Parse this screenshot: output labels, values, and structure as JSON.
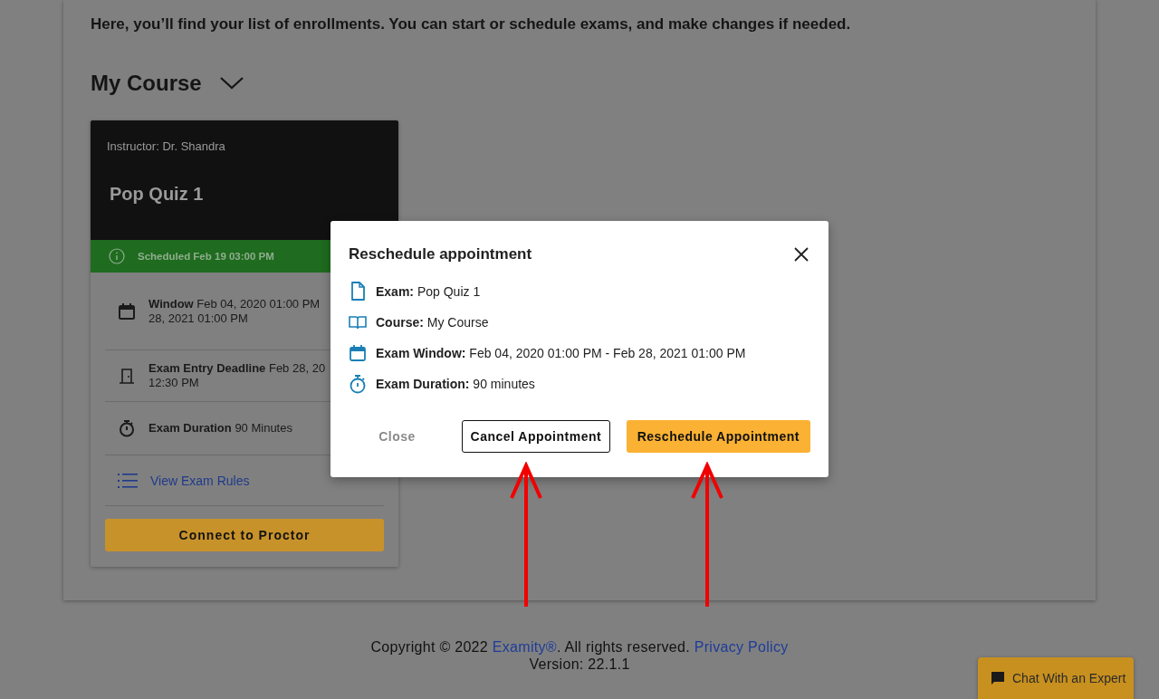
{
  "intro": "Here, you’ll find your list of enrollments. You can start or schedule exams, and make changes if needed.",
  "course": {
    "title": "My Course"
  },
  "card": {
    "instructor": "Instructor: Dr. Shandra",
    "title": "Pop Quiz 1",
    "status": "Scheduled Feb 19 03:00 PM",
    "rows": [
      {
        "kind": "window",
        "label": "Window",
        "lines": [
          "Feb 04, 2020 01:00 PM",
          "28, 2021 01:00 PM"
        ]
      },
      {
        "kind": "deadline",
        "label": "Exam Entry Deadline",
        "lines": [
          "Feb 28, 20",
          "12:30 PM"
        ]
      },
      {
        "kind": "duration",
        "label": "Exam Duration",
        "lines": [
          "90 Minutes"
        ]
      },
      {
        "kind": "rules",
        "label": "View Exam Rules"
      }
    ],
    "button": "Connect to Proctor"
  },
  "modal": {
    "title": "Reschedule appointment",
    "items": [
      {
        "kind": "exam",
        "label": "Exam:",
        "value": "Pop Quiz 1"
      },
      {
        "kind": "course",
        "label": "Course:",
        "value": "My Course"
      },
      {
        "kind": "window",
        "label": "Exam Window:",
        "value": "Feb 04, 2020 01:00 PM - Feb 28, 2021 01:00 PM"
      },
      {
        "kind": "duration",
        "label": "Exam Duration:",
        "value": "90 minutes"
      }
    ],
    "buttons": [
      {
        "kind": "text",
        "label": "Close"
      },
      {
        "kind": "outline",
        "label": "Cancel Appointment"
      },
      {
        "kind": "primary",
        "label": "Reschedule Appointment"
      }
    ]
  },
  "annotations": [
    {
      "kind": "arrow"
    },
    {
      "kind": "arrow"
    }
  ],
  "footer": {
    "copyright": "Copyright © 2022",
    "brand": "Examity®",
    "rights": ". All rights reserved.",
    "privacy": "Privacy Policy",
    "version": "Version: 22.1.1"
  },
  "chat": {
    "label": "Chat With an Expert"
  }
}
